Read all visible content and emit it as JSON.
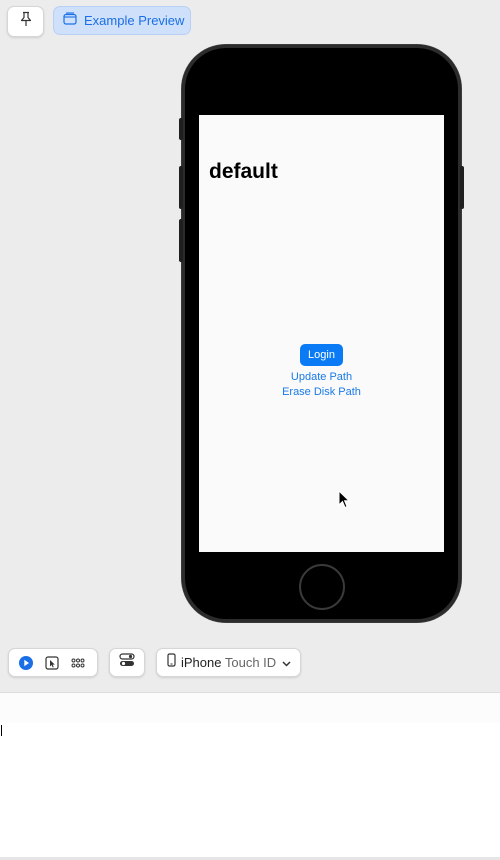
{
  "toolbar_top": {
    "pin_icon": "pin-icon",
    "preview_icon": "window-icon",
    "preview_label": "Example Preview"
  },
  "device_screen": {
    "title": "default",
    "login_label": "Login",
    "update_path_label": "Update Path",
    "erase_disk_path_label": "Erase Disk Path",
    "accent_color": "#0a7bf5"
  },
  "toolbar_bottom": {
    "live_icon": "play-circle-icon",
    "select_icon": "cursor-select-icon",
    "variants_icon": "grid-icon",
    "settings_icon": "toggle-settings-icon",
    "device_icon": "phone-icon",
    "device_name_main": "iPhone",
    "device_name_sub": "Touch ID",
    "dropdown_icon": "chevron-down-icon"
  }
}
